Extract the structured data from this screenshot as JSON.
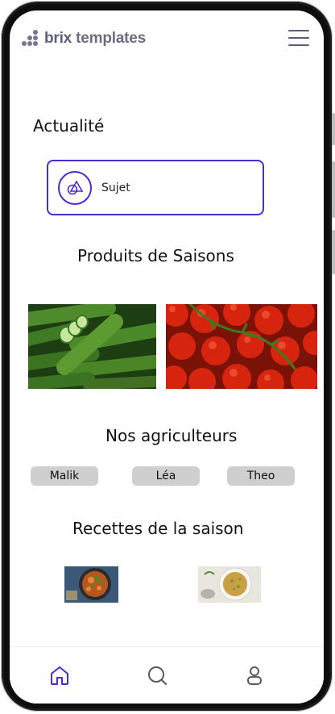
{
  "brand": {
    "name_bold": "brix",
    "name_rest": "templates"
  },
  "header": {
    "menu_icon": "hamburger-menu-icon"
  },
  "news": {
    "title": "Actualité",
    "card_label": "Sujet",
    "card_icon": "shapes-icon"
  },
  "seasonal_products": {
    "title": "Produits de Saisons",
    "items": [
      "cucumbers",
      "tomatoes"
    ]
  },
  "farmers": {
    "title": "Nos agriculteurs",
    "names": [
      "Malik",
      "Léa",
      "Theo"
    ]
  },
  "recipes": {
    "title": "Recettes de la saison",
    "items": [
      "vegetable-bowl",
      "grain-dish"
    ]
  },
  "bottom_nav": {
    "items": [
      "home-icon",
      "search-icon",
      "profile-icon"
    ],
    "active": "home-icon"
  },
  "colors": {
    "accent": "#4a2bd6",
    "chip_bg": "#cfcfcf",
    "nav_icon": "#5a5a5a",
    "nav_active": "#4a2bd6"
  }
}
